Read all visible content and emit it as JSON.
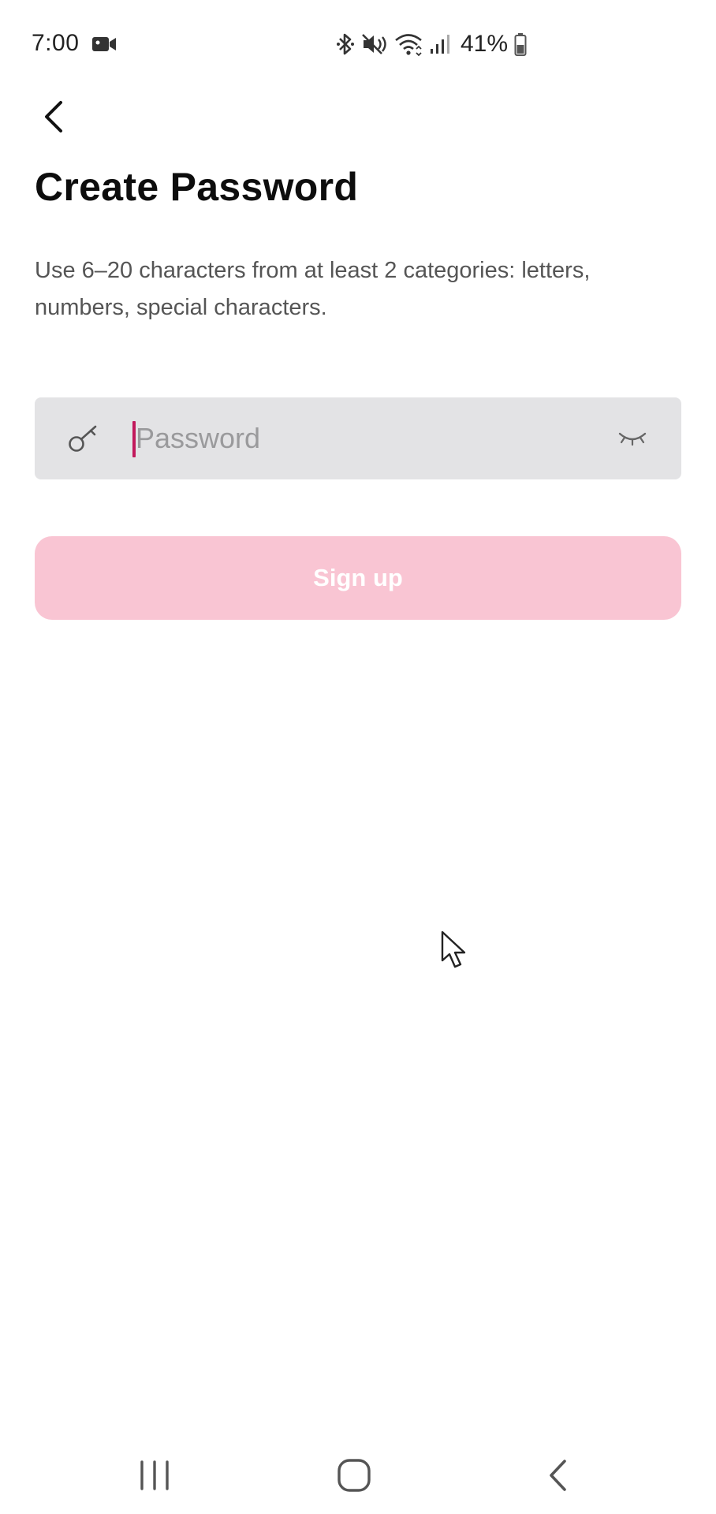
{
  "status_bar": {
    "time": "7:00",
    "battery_percent": "41%",
    "icons": [
      "video-icon",
      "bluetooth-icon",
      "mute-icon",
      "wifi-icon",
      "signal-icon",
      "battery-icon"
    ]
  },
  "header": {
    "back_icon": "back-arrow-icon"
  },
  "page": {
    "title": "Create Password",
    "description": "Use 6–20 characters from at least 2 categories: letters, numbers, special characters."
  },
  "password_field": {
    "value": "",
    "placeholder": "Password",
    "leading_icon": "key-icon",
    "trailing_icon": "eye-closed-icon",
    "caret_color": "#c2185b"
  },
  "signup_button": {
    "label": "Sign up",
    "background": "#f9c5d3",
    "text_color": "#ffffff"
  },
  "navigation_bar": {
    "icons": [
      "recents-icon",
      "home-icon",
      "nav-back-icon"
    ]
  }
}
